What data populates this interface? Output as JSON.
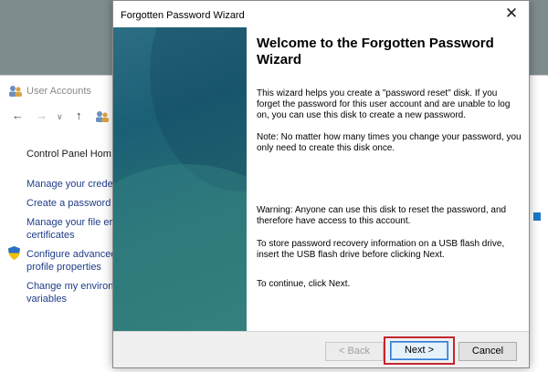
{
  "background_window": {
    "title": "User Accounts",
    "nav": {
      "back_glyph": "←",
      "forward_glyph": "→",
      "dropdown_glyph": "∨",
      "up_glyph": "↑"
    },
    "control_panel_home": "Control Panel Hom",
    "links": [
      "Manage your crede",
      "Create a password r",
      "Manage your file er",
      "certificates",
      "Configure advanced",
      "profile properties",
      "Change my environ",
      "variables"
    ]
  },
  "dialog": {
    "title": "Forgotten Password Wizard",
    "close_glyph": "✕",
    "heading": "Welcome to the Forgotten Password Wizard",
    "paragraphs": [
      "This wizard helps you create a \"password reset\" disk. If you forget the password for this user account and are unable to log on, you can use this disk to create a new password.",
      "Note: No matter how many times you change your password, you only need to create this disk once.",
      "Warning: Anyone can use this disk to reset the password, and therefore have access to this account.",
      "To store password recovery information on a USB flash drive, insert the USB flash drive before clicking Next.",
      "To continue, click Next."
    ],
    "buttons": {
      "back": "< Back",
      "next": "Next >",
      "cancel": "Cancel"
    },
    "highlight_color": "#c4262e"
  }
}
